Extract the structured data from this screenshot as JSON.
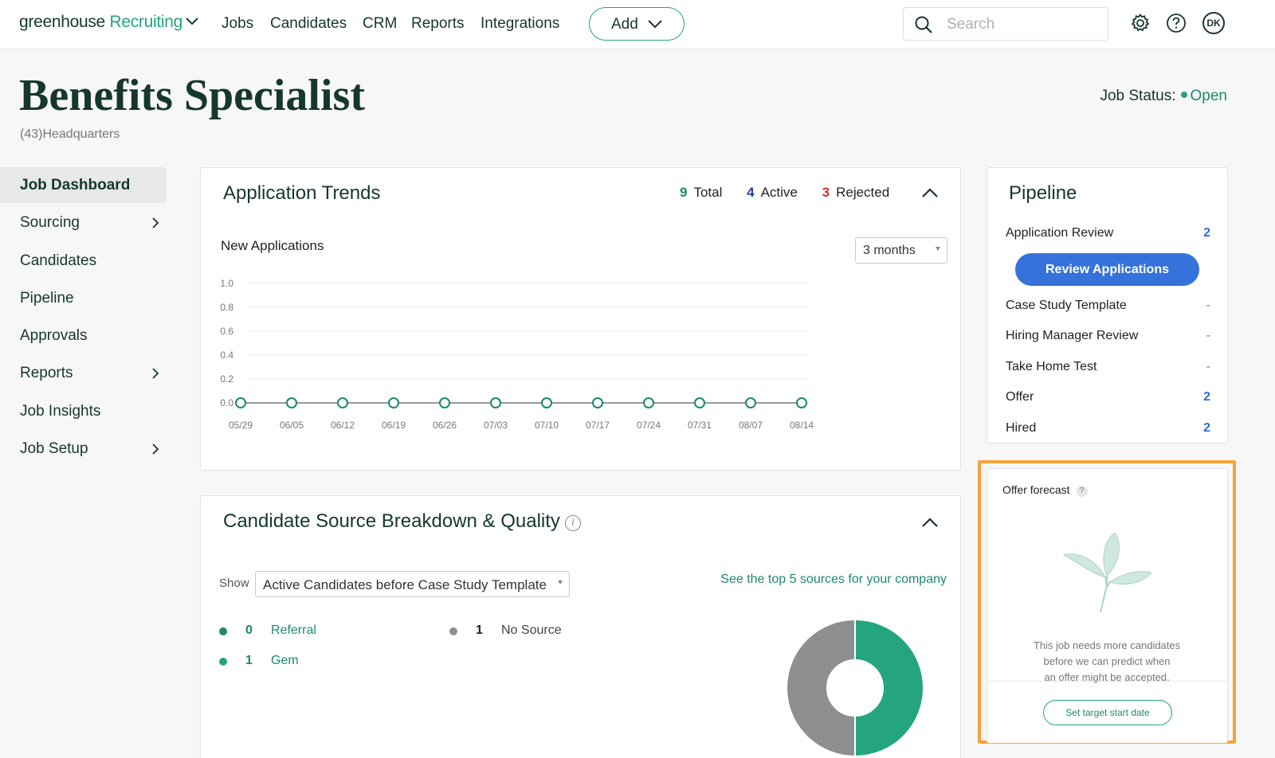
{
  "nav": {
    "logo_brand": "greenhouse",
    "logo_product": "Recruiting",
    "links": [
      "Jobs",
      "Candidates",
      "CRM",
      "Reports",
      "Integrations"
    ],
    "add_label": "Add",
    "search_placeholder": "Search",
    "avatar_initials": "DK"
  },
  "header": {
    "title": "Benefits Specialist",
    "subtitle": "(43)Headquarters",
    "status_label": "Job Status:",
    "status_value": "Open"
  },
  "sidebar": {
    "items": [
      {
        "label": "Job Dashboard",
        "active": true,
        "chevron": false
      },
      {
        "label": "Sourcing",
        "chevron": true
      },
      {
        "label": "Candidates",
        "chevron": false
      },
      {
        "label": "Pipeline",
        "chevron": false
      },
      {
        "label": "Approvals",
        "chevron": false
      },
      {
        "label": "Reports",
        "chevron": true
      },
      {
        "label": "Job Insights",
        "chevron": false
      },
      {
        "label": "Job Setup",
        "chevron": true
      }
    ]
  },
  "trends": {
    "title": "Application Trends",
    "total_count": "9",
    "total_label": "Total",
    "active_count": "4",
    "active_label": "Active",
    "rejected_count": "3",
    "rejected_label": "Rejected",
    "subtitle": "New Applications",
    "range_select": "3 months"
  },
  "chart_data": {
    "type": "line",
    "title": "New Applications",
    "x": [
      "05/29",
      "06/05",
      "06/12",
      "06/19",
      "06/26",
      "07/03",
      "07/10",
      "07/17",
      "07/24",
      "07/31",
      "08/07",
      "08/14"
    ],
    "series": [
      {
        "values": [
          0,
          0,
          0,
          0,
          0,
          0,
          0,
          0,
          0,
          0,
          0,
          0
        ]
      }
    ],
    "yticks": [
      "0.0",
      "0.2",
      "0.4",
      "0.6",
      "0.8",
      "1.0"
    ],
    "ylim": [
      0,
      1
    ],
    "grid": true,
    "colors": {
      "line": "#999999",
      "marker": "#1c8a69",
      "grid": "#e6e6e6"
    }
  },
  "sources": {
    "title": "Candidate Source Breakdown & Quality",
    "show_label": "Show",
    "show_select": "Active Candidates before Case Study Template",
    "top5_link": "See the top 5 sources for your company",
    "items": [
      {
        "count": "0",
        "name": "Referral",
        "color": "#1c8a69"
      },
      {
        "count": "1",
        "name": "Gem",
        "color": "#24a47f"
      },
      {
        "count": "1",
        "name": "No Source",
        "color": "#8f8f8f"
      }
    ],
    "donut": [
      {
        "name": "Gem",
        "value": 1,
        "color": "#24a47f"
      },
      {
        "name": "No Source",
        "value": 1,
        "color": "#8f8f8f"
      }
    ]
  },
  "pipeline": {
    "title": "Pipeline",
    "stages": [
      {
        "name": "Application Review",
        "count": "2"
      },
      {
        "name": "Case Study Template",
        "count": "-"
      },
      {
        "name": "Hiring Manager Review",
        "count": "-"
      },
      {
        "name": "Take Home Test",
        "count": "-"
      },
      {
        "name": "Offer",
        "count": "2"
      },
      {
        "name": "Hired",
        "count": "2"
      }
    ],
    "review_button": "Review Applications"
  },
  "offer_forecast": {
    "title": "Offer forecast",
    "help": "?",
    "message_lines": [
      "This job needs more candidates",
      "before we can predict when",
      "an offer might be accepted."
    ],
    "button": "Set target start date"
  },
  "colors": {
    "brand_green": "#24a47f",
    "dark_green": "#15372c",
    "primary_blue": "#3572d9",
    "active_blue": "#1f3fa0",
    "rejected_red": "#d93030",
    "highlight_orange": "#f8a23b"
  }
}
